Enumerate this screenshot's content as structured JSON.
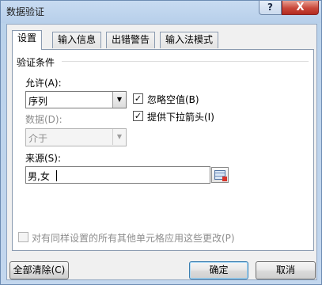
{
  "title": "数据验证",
  "titlebar": {
    "help": "?",
    "close": "X"
  },
  "tabs": [
    {
      "label": "设置"
    },
    {
      "label": "输入信息"
    },
    {
      "label": "出错警告"
    },
    {
      "label": "输入法模式"
    }
  ],
  "settings": {
    "group_title": "验证条件",
    "allow_label": "允许(A):",
    "allow_value": "序列",
    "data_label": "数据(D):",
    "data_value": "介于",
    "ignore_blank_label": "忽略空值(B)",
    "ignore_blank_checked": true,
    "dropdown_label": "提供下拉箭头(I)",
    "dropdown_checked": true,
    "source_label": "来源(S):",
    "source_value": "男,女",
    "apply_all_label": "对有同样设置的所有其他单元格应用这些更改(P)",
    "apply_all_checked": false
  },
  "buttons": {
    "clear_all": "全部清除(C)",
    "ok": "确定",
    "cancel": "取消"
  },
  "glyphs": {
    "check": "✓",
    "arrow": "▼"
  }
}
